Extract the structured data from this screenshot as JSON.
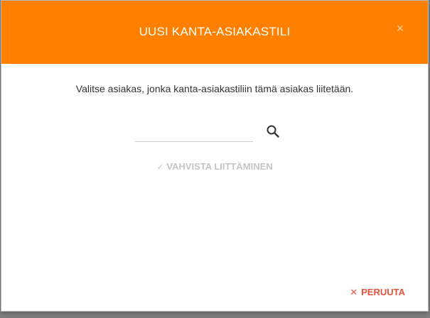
{
  "modal": {
    "title": "UUSI KANTA-ASIAKASTILI",
    "close_symbol": "×",
    "instruction": "Valitse asiakas, jonka kanta-asiakastiliin tämä asiakas liitetään.",
    "search": {
      "value": "",
      "placeholder": "",
      "icon": "search-icon"
    },
    "confirm": {
      "icon": "check-icon",
      "label": "VAHVISTA LIITTÄMINEN",
      "disabled": true
    },
    "cancel": {
      "icon": "close-icon",
      "label": "PERUUTA"
    }
  },
  "colors": {
    "header": "#ff8000",
    "cancel": "#e5533d",
    "disabled": "#c4c4c4"
  }
}
